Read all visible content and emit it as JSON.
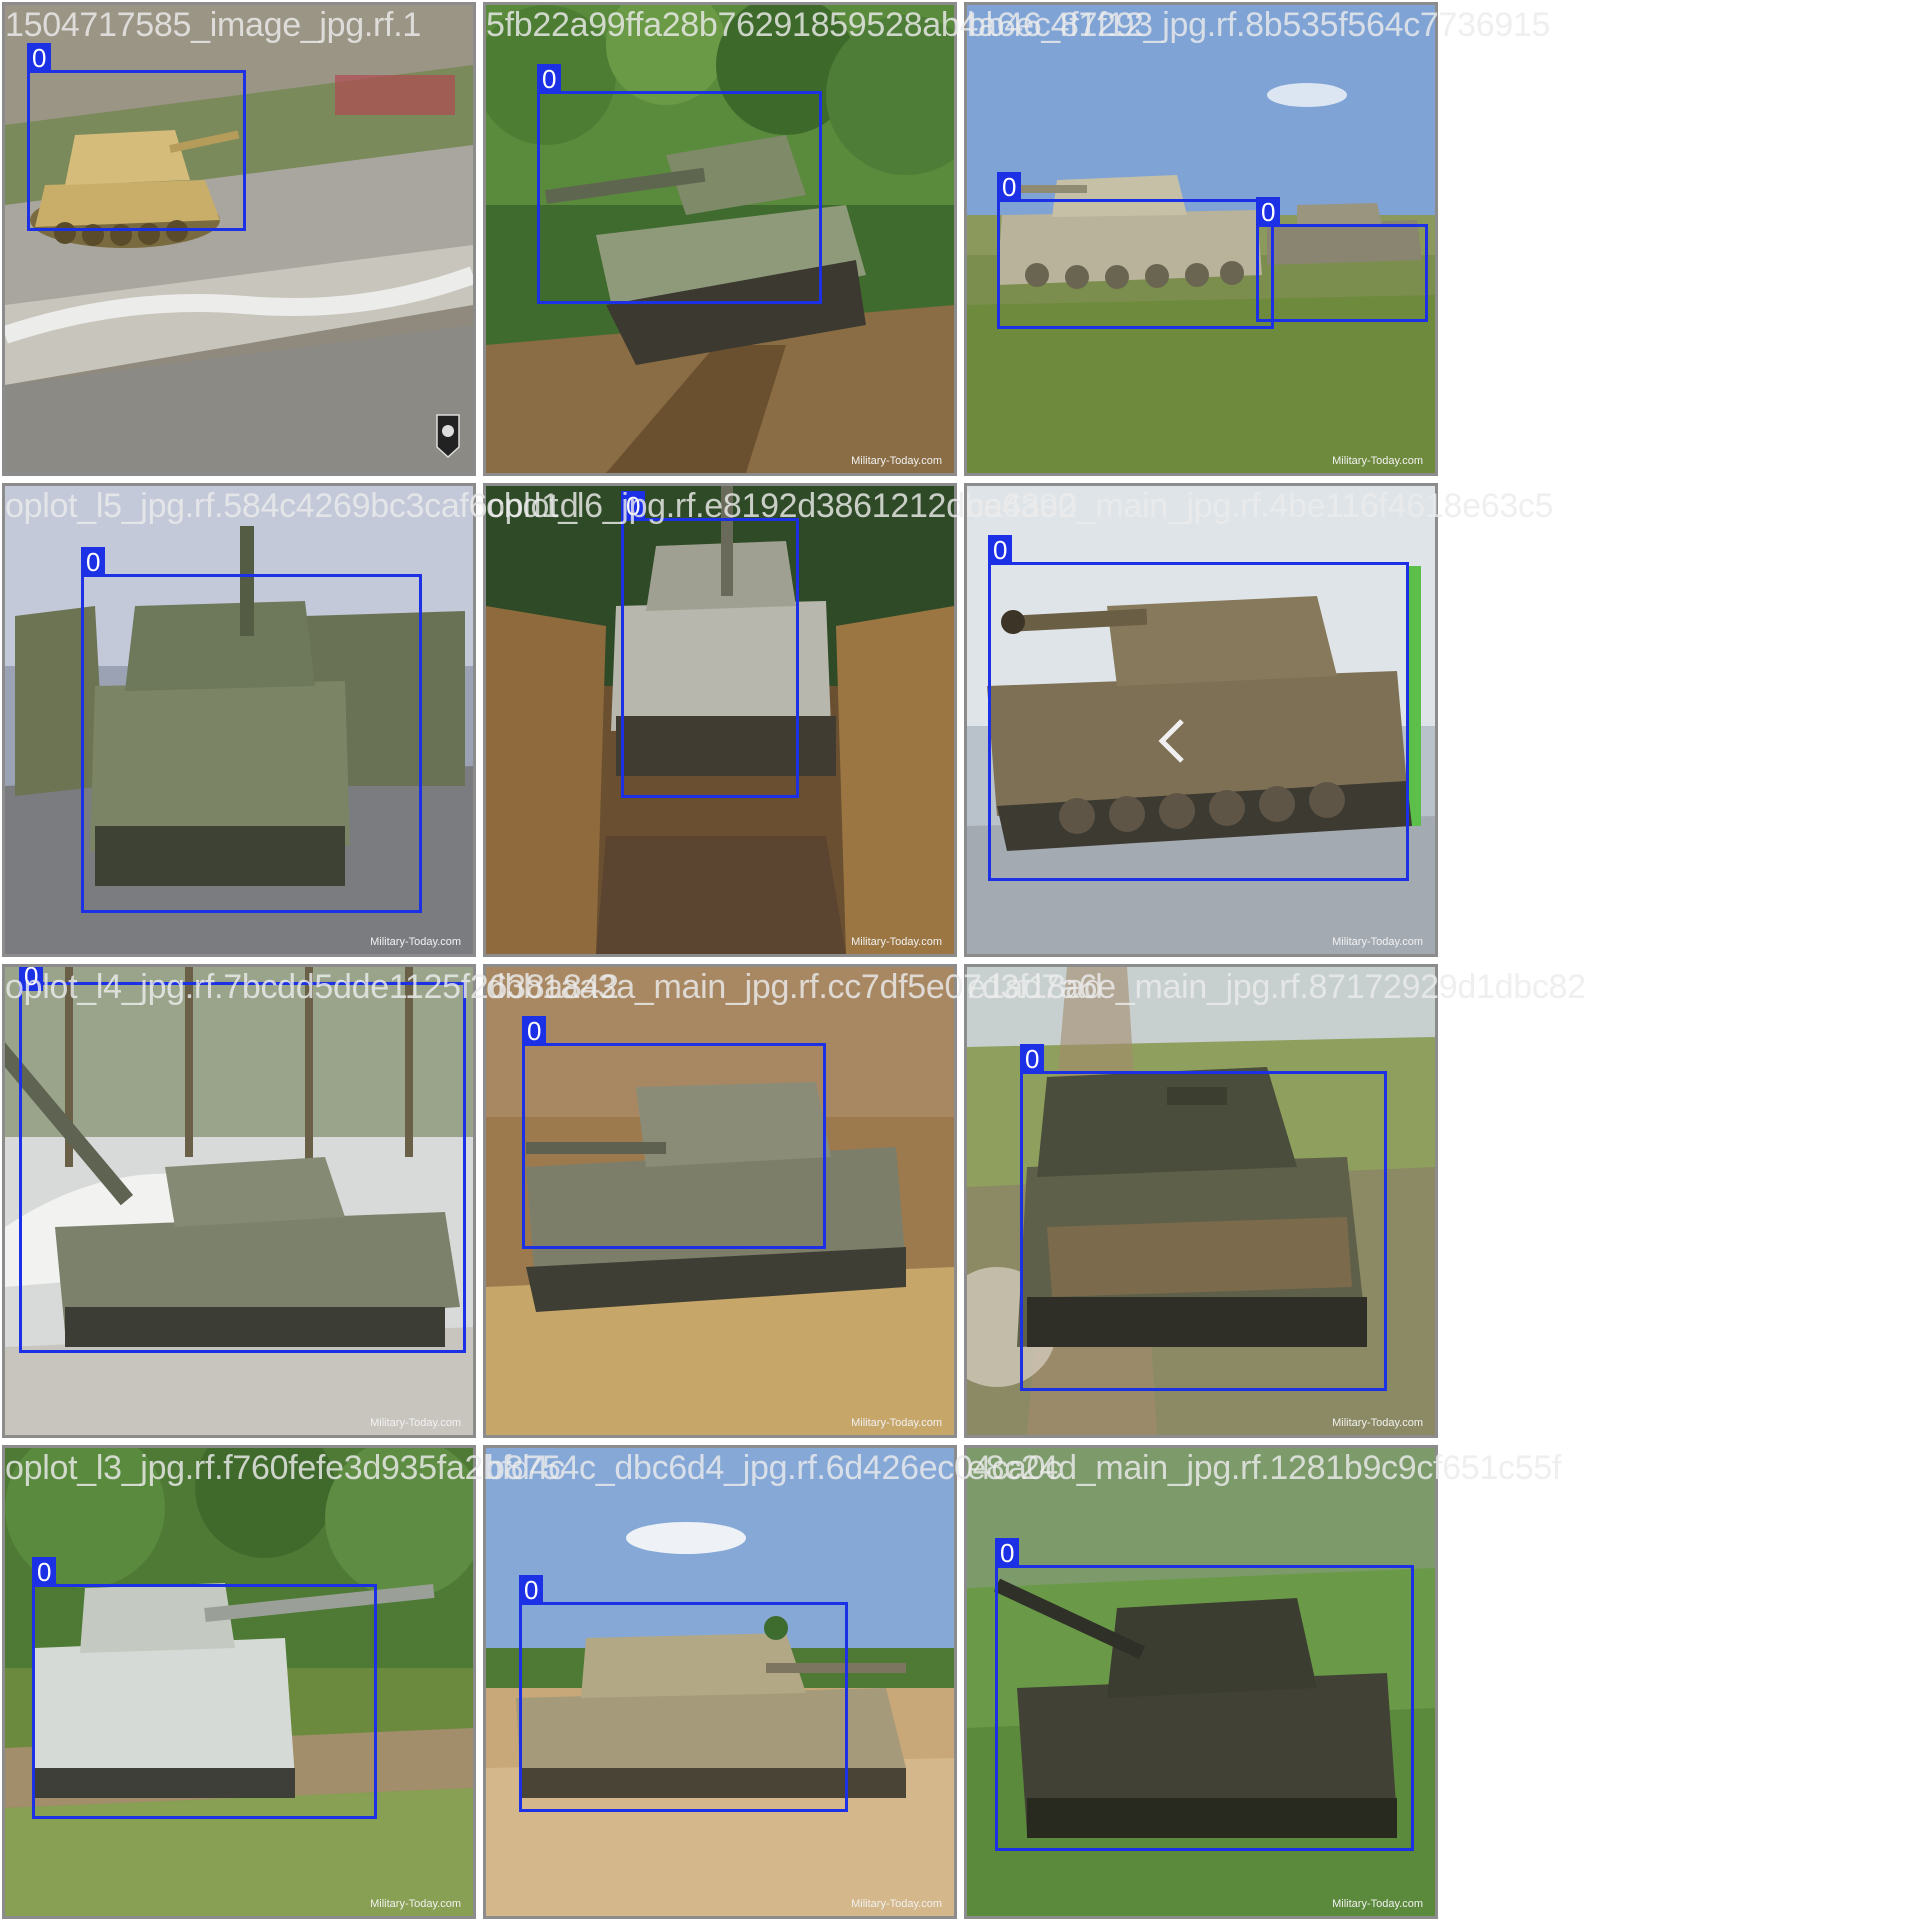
{
  "colors": {
    "bbox": "#1c31e6",
    "label_text": "#ffffff",
    "tile_border": "#8c8c8c",
    "filename_text": "#ebebeb"
  },
  "tiles": [
    {
      "filename": "1504717585_image_jpg.rf.1",
      "label": "0",
      "watermark": ""
    },
    {
      "filename": "5fb22a99ffa28b76291859528ab4a6ec4f1293",
      "label": "0",
      "watermark": "Military-Today.com"
    },
    {
      "filename": "bb46_87f12_jpg.rf.8b535f564c7736915",
      "label": "0",
      "watermark": "Military-Today.com"
    },
    {
      "filename": "oplot_l5_jpg.rf.584c4269bc3caf6cbd1d",
      "label": "0",
      "watermark": "Military-Today.com"
    },
    {
      "filename": "oplot_l6_jpg.rf.e8192d3861212dbe4a90",
      "label": "0",
      "watermark": "Military-Today.com"
    },
    {
      "filename": "ca63e2_main_jpg.rf.4be116f4618e63c5",
      "label": "0",
      "watermark": "Military-Today.com"
    },
    {
      "filename": "oplot_l4_jpg.rf.7bcdd5dde1125f2638a842",
      "label": "0",
      "watermark": "Military-Today.com"
    },
    {
      "filename": "dbb1aa3a_main_jpg.rf.cc7df5e07d3f18ad",
      "label": "0",
      "watermark": "Military-Today.com"
    },
    {
      "filename": "e1ad7a6e_main_jpg.rf.87172929d1dbc82",
      "label": "0",
      "watermark": "Military-Today.com"
    },
    {
      "filename": "oplot_l3_jpg.rf.f760fefe3d935fa2bfd4c",
      "label": "0",
      "watermark": "Military-Today.com"
    },
    {
      "filename": "b8754c_dbc6d4_jpg.rf.6d426ec04ca0c",
      "label": "0",
      "watermark": "Military-Today.com"
    },
    {
      "filename": "e8c24d_main_jpg.rf.1281b9c9cf651c55f",
      "label": "0",
      "watermark": "Military-Today.com"
    }
  ]
}
